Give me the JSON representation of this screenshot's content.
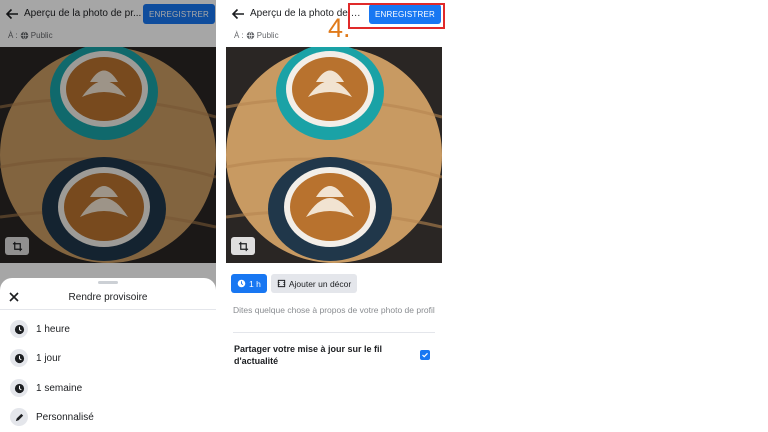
{
  "left_screen": {
    "title": "Aperçu de la photo de pr...",
    "save_label": "ENREGISTRER",
    "audience_prefix": "À :",
    "audience_value": "Public",
    "sheet": {
      "title": "Rendre provisoire",
      "items": [
        {
          "label": "1 heure",
          "icon": "clock-icon"
        },
        {
          "label": "1 jour",
          "icon": "clock-icon"
        },
        {
          "label": "1 semaine",
          "icon": "clock-icon"
        },
        {
          "label": "Personnalisé",
          "icon": "pencil-icon"
        }
      ]
    }
  },
  "right_screen": {
    "title": "Aperçu de la photo de pr...",
    "save_label": "ENREGISTRER",
    "audience_prefix": "À :",
    "audience_value": "Public",
    "time_chip": "1 h",
    "decor_chip": "Ajouter un décor",
    "caption_placeholder": "Dites quelque chose à propos de votre photo de profil",
    "share_label": "Partager votre mise à jour sur le fil d'actualité",
    "share_checked": true
  },
  "annotation": {
    "step": "4.",
    "color": "#e02a2a"
  },
  "colors": {
    "accent": "#1877f2",
    "step_label": "#e07a1a"
  }
}
